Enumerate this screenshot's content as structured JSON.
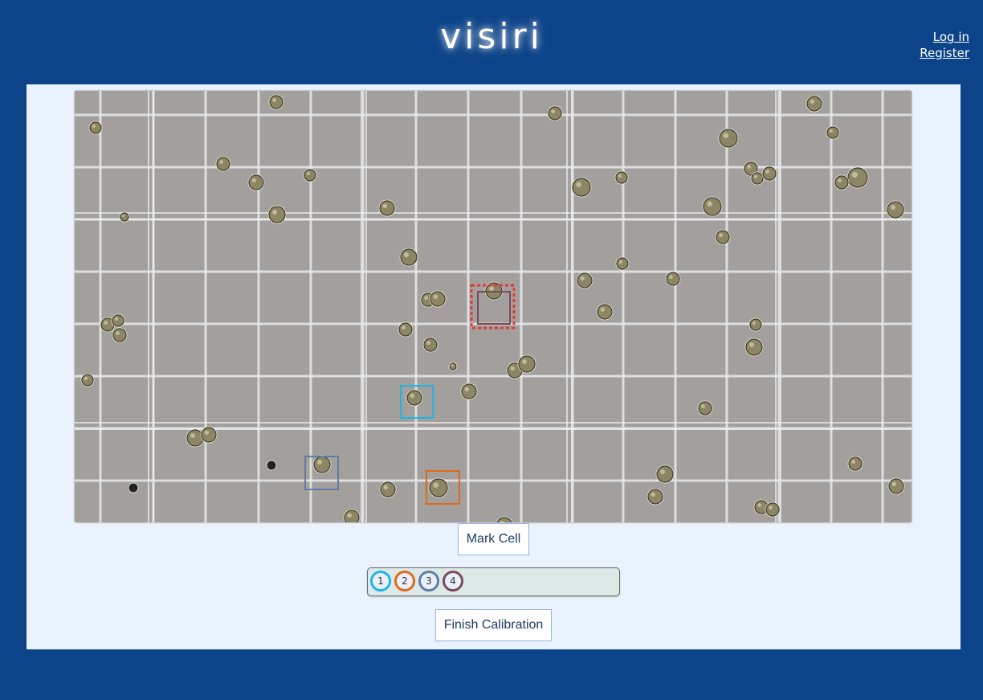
{
  "header": {
    "brand": "visiri",
    "login_label": "Log in",
    "register_label": "Register"
  },
  "actions": {
    "mark_cell_label": "Mark Cell",
    "finish_label": "Finish Calibration"
  },
  "calibration_slots": [
    {
      "label": "1",
      "color": "#1fb5ea"
    },
    {
      "label": "2",
      "color": "#e06a1b"
    },
    {
      "label": "3",
      "color": "#5f7ea3"
    },
    {
      "label": "4",
      "color": "#7a4a5c"
    }
  ],
  "colors": {
    "page_bg": "#0d4489",
    "panel_bg": "#eaf3fd",
    "image_bg": "#a39f9c",
    "selection": "#e03a3a"
  }
}
